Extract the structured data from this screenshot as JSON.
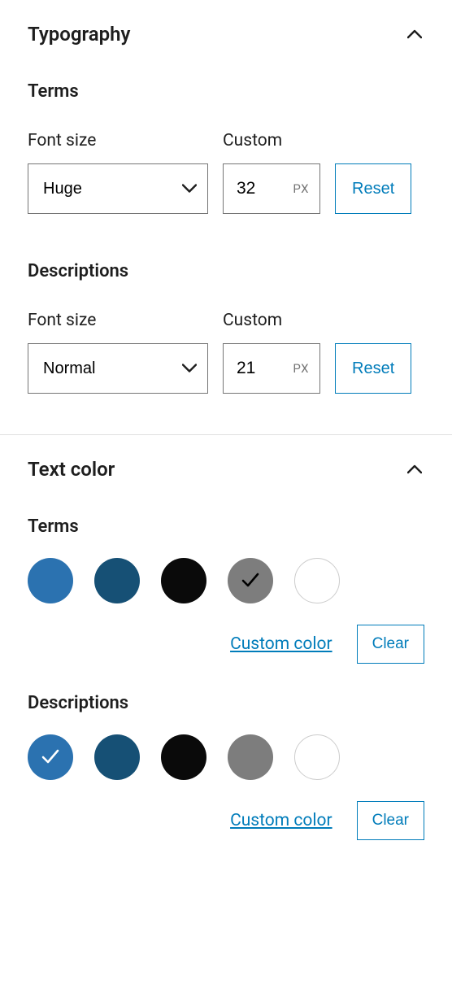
{
  "typography": {
    "panel_title": "Typography",
    "terms": {
      "title": "Terms",
      "font_size_label": "Font size",
      "custom_label": "Custom",
      "font_size_value": "Huge",
      "custom_value": "32",
      "unit": "PX",
      "reset_label": "Reset"
    },
    "descriptions": {
      "title": "Descriptions",
      "font_size_label": "Font size",
      "custom_label": "Custom",
      "font_size_value": "Normal",
      "custom_value": "21",
      "unit": "PX",
      "reset_label": "Reset"
    }
  },
  "text_color": {
    "panel_title": "Text color",
    "terms": {
      "title": "Terms",
      "colors": [
        {
          "hex": "#2b72b0",
          "white_border": false
        },
        {
          "hex": "#165075",
          "white_border": false
        },
        {
          "hex": "#0a0a0a",
          "white_border": false
        },
        {
          "hex": "#7d7d7d",
          "white_border": false
        },
        {
          "hex": "#ffffff",
          "white_border": true
        }
      ],
      "selected_index": 3,
      "check_dark": true,
      "custom_color_label": "Custom color",
      "clear_label": "Clear"
    },
    "descriptions": {
      "title": "Descriptions",
      "colors": [
        {
          "hex": "#2b72b0",
          "white_border": false
        },
        {
          "hex": "#165075",
          "white_border": false
        },
        {
          "hex": "#0a0a0a",
          "white_border": false
        },
        {
          "hex": "#7d7d7d",
          "white_border": false
        },
        {
          "hex": "#ffffff",
          "white_border": true
        }
      ],
      "selected_index": 0,
      "check_dark": false,
      "custom_color_label": "Custom color",
      "clear_label": "Clear"
    }
  }
}
